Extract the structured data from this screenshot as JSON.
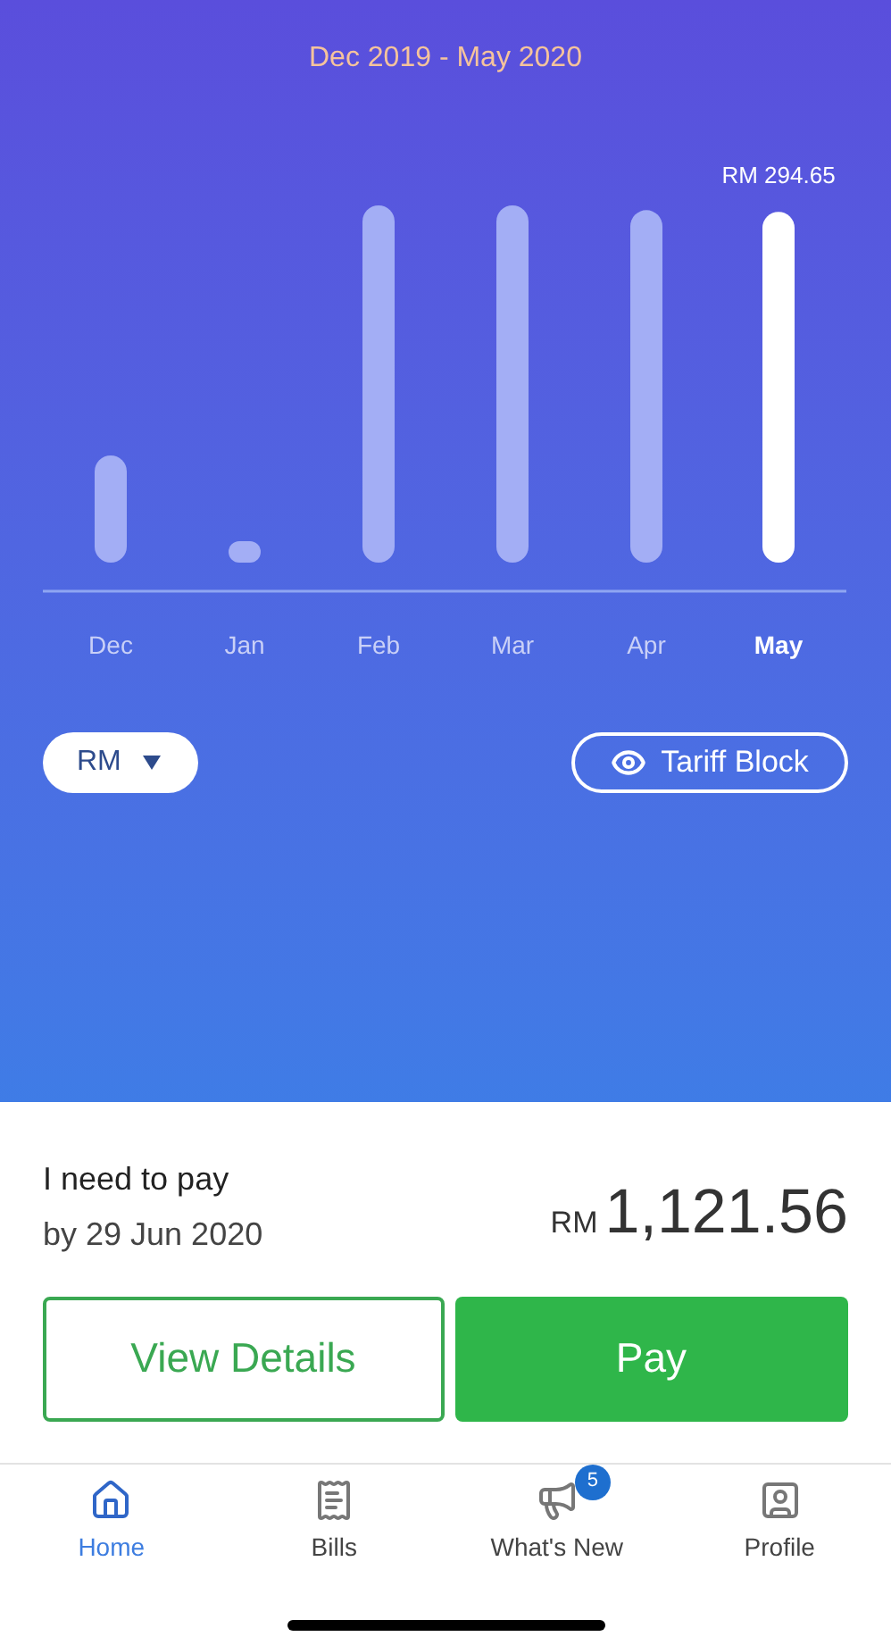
{
  "period": "Dec 2019 - May 2020",
  "chart_data": {
    "type": "bar",
    "categories": [
      "Dec",
      "Jan",
      "Feb",
      "Mar",
      "Apr",
      "May"
    ],
    "values": [
      90,
      18,
      300,
      300,
      296,
      294.65
    ],
    "value_labels": [
      null,
      null,
      null,
      null,
      null,
      "RM 294.65"
    ]
  },
  "unit_dropdown": {
    "value": "RM"
  },
  "tariff_button": {
    "label": "Tariff Block"
  },
  "payment": {
    "title": "I need to pay",
    "due": "by 29 Jun 2020",
    "currency": "RM",
    "amount": "1,121.56"
  },
  "buttons": [
    {
      "kind": "outline",
      "label": "View Details"
    },
    {
      "kind": "filled",
      "label": "Pay"
    }
  ],
  "nav": [
    {
      "label": "Home",
      "selected": true
    },
    {
      "label": "Bills",
      "selected": false
    },
    {
      "label": "What's New",
      "selected": false,
      "badge": "5"
    },
    {
      "label": "Profile",
      "selected": false
    }
  ]
}
